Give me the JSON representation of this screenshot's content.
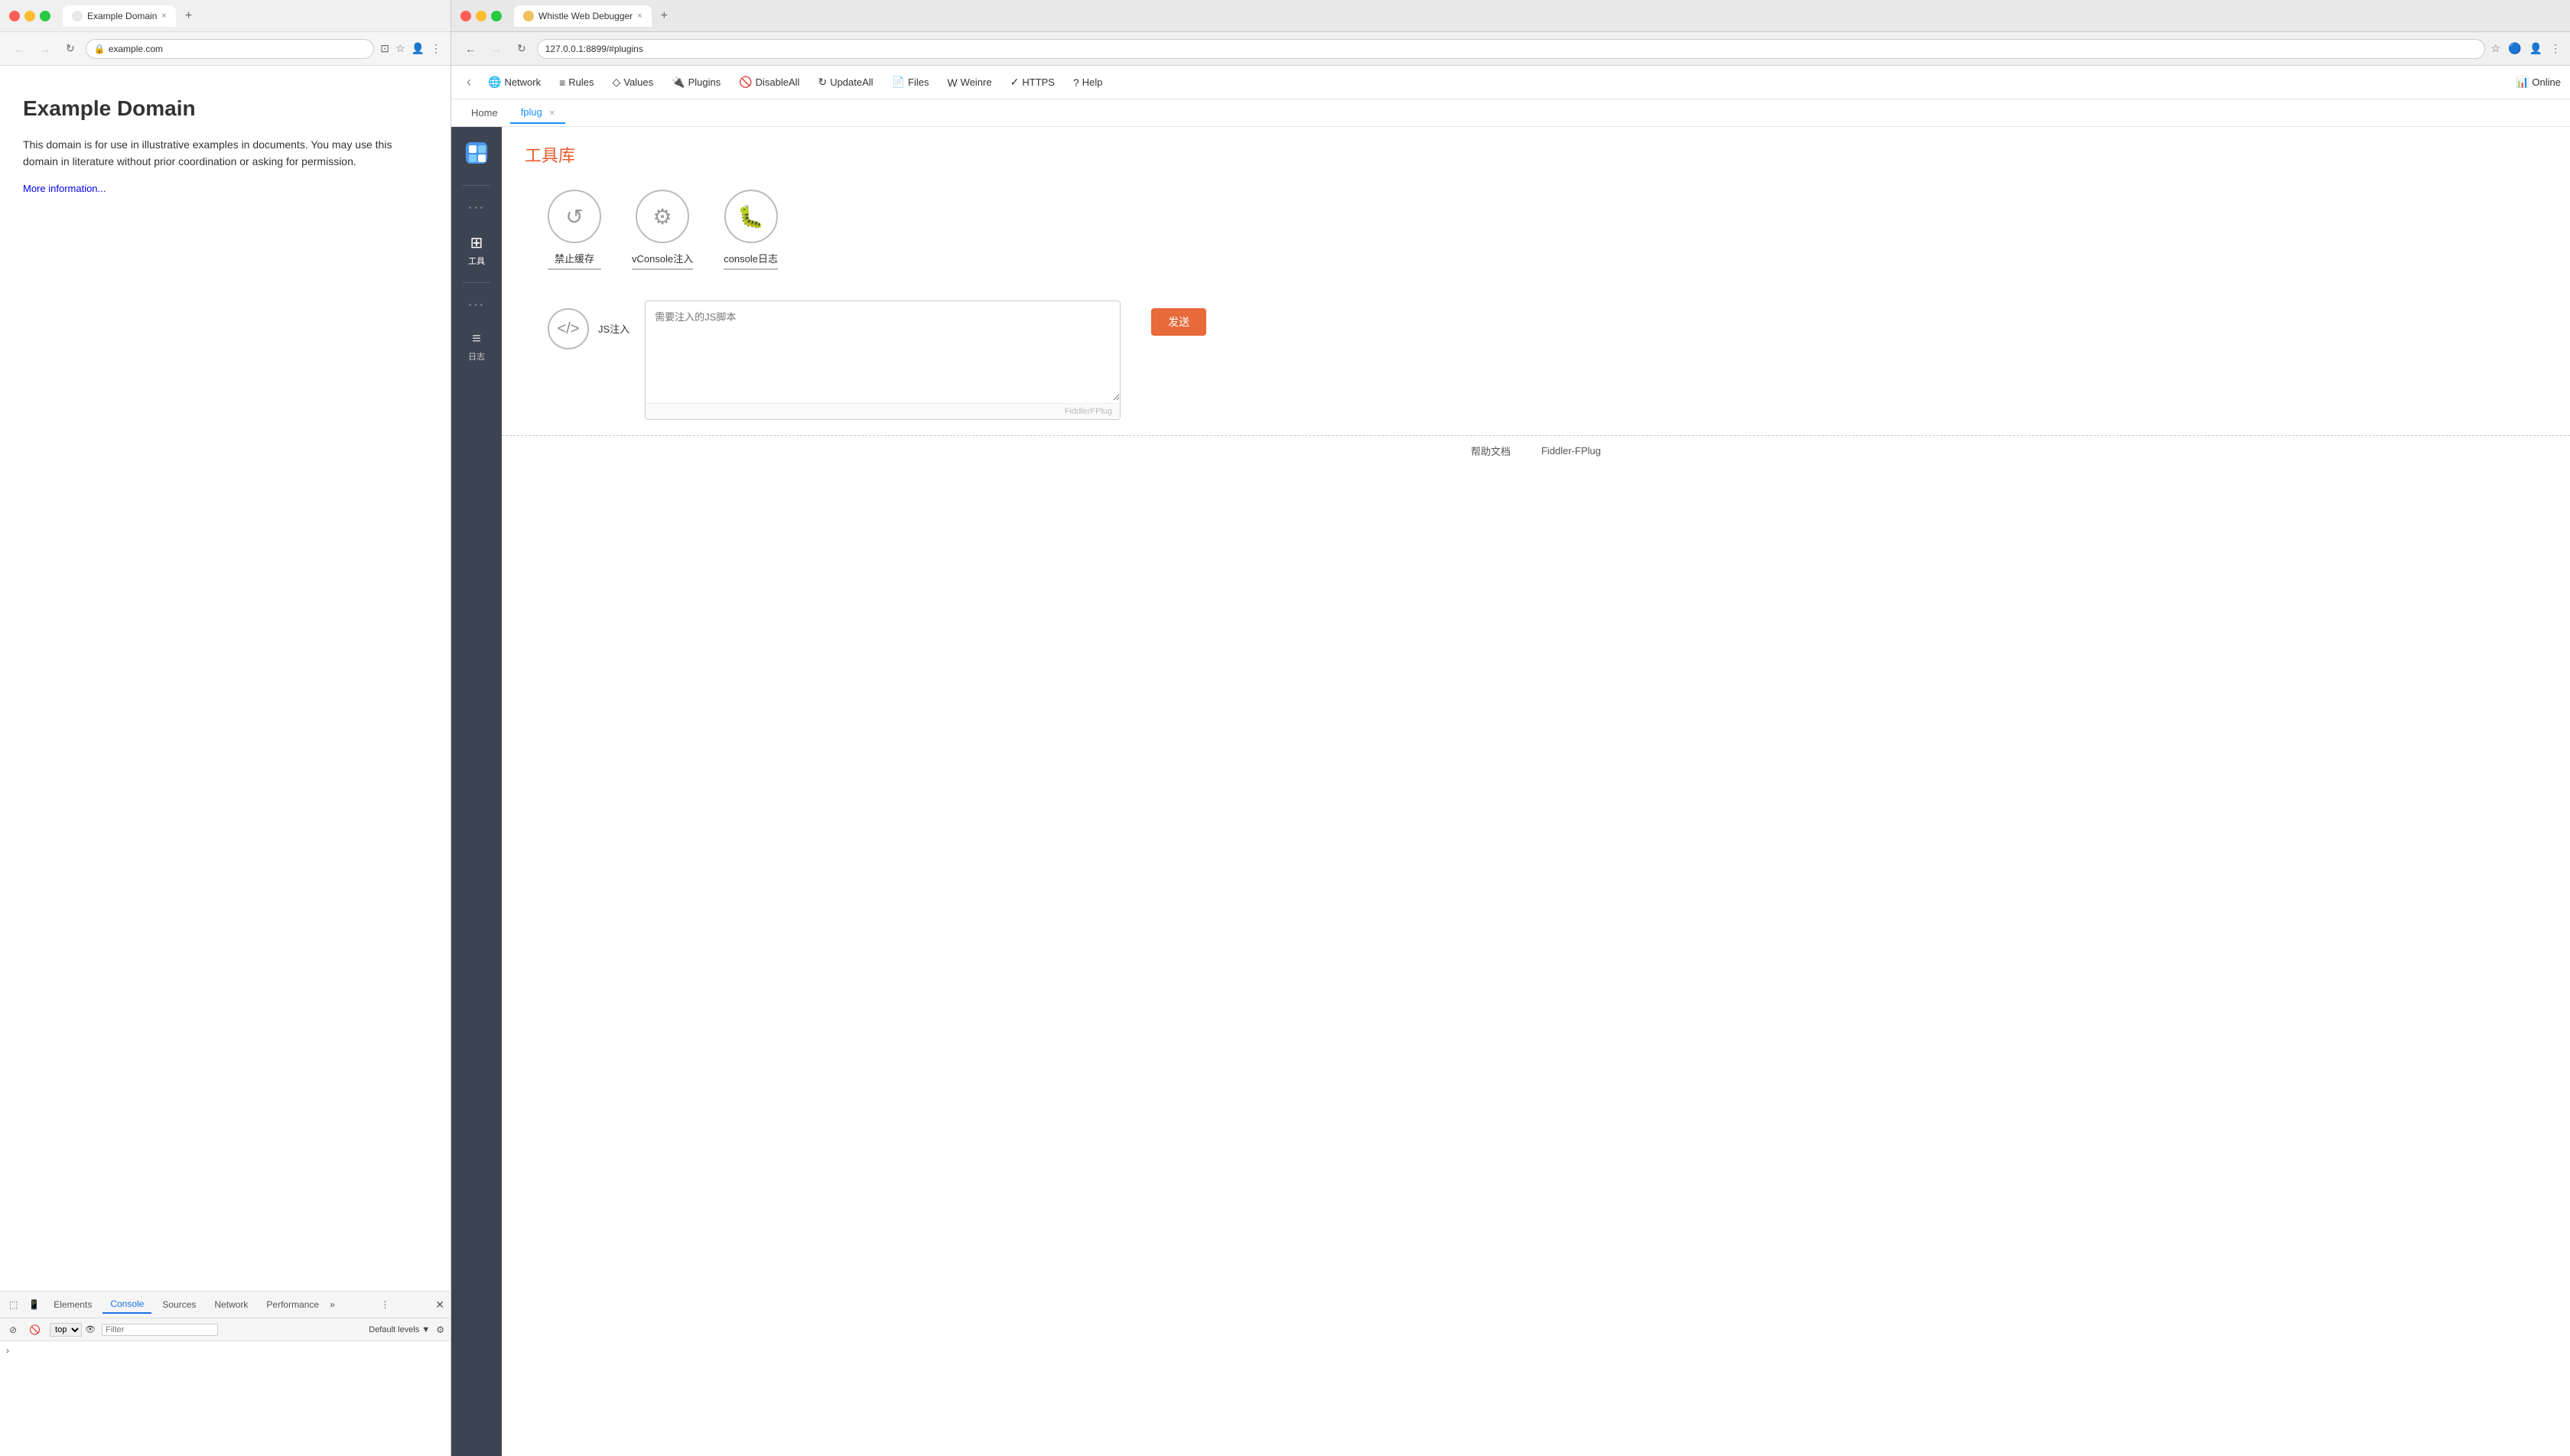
{
  "leftBrowser": {
    "tab": {
      "label": "Example Domain",
      "closeBtn": "×"
    },
    "newTab": "+",
    "addressBar": "example.com",
    "page": {
      "title": "Example Domain",
      "body1": "This domain is for use in illustrative examples in documents. You may use this domain in literature without prior coordination or asking for permission.",
      "linkText": "More information..."
    },
    "devtools": {
      "tabs": [
        "Elements",
        "Console",
        "Sources",
        "Network",
        "Performance"
      ],
      "activeTab": "Console",
      "moreLabel": "»",
      "consoleToolbar": {
        "topLabel": "top",
        "filterPlaceholder": "Filter",
        "levelsLabel": "Default levels ▼"
      }
    }
  },
  "rightBrowser": {
    "tab": {
      "label": "Whistle Web Debugger",
      "closeBtn": "×"
    },
    "newTab": "+",
    "addressBar": "127.0.0.1:8899/#plugins",
    "menubar": {
      "backArrow": "‹",
      "items": [
        {
          "icon": "🌐",
          "label": "Network"
        },
        {
          "icon": "≡",
          "label": "Rules"
        },
        {
          "icon": "◇",
          "label": "Values"
        },
        {
          "icon": "🔌",
          "label": "Plugins"
        },
        {
          "icon": "🚫",
          "label": "DisableAll"
        },
        {
          "icon": "↻",
          "label": "UpdateAll"
        },
        {
          "icon": "📄",
          "label": "Files"
        },
        {
          "icon": "W",
          "label": "Weinre"
        },
        {
          "icon": "✓",
          "label": "HTTPS"
        },
        {
          "icon": "?",
          "label": "Help"
        }
      ],
      "onlineLabel": "Online"
    },
    "tabs": [
      {
        "label": "Home",
        "active": false
      },
      {
        "label": "fplug",
        "active": true,
        "closeable": true
      }
    ]
  },
  "sidebar": {
    "items": [
      {
        "type": "dots",
        "label": "",
        "active": false
      },
      {
        "type": "icon",
        "icon": "⊞",
        "label": "工具",
        "active": true
      },
      {
        "type": "dots",
        "label": "",
        "active": false
      },
      {
        "type": "icon",
        "icon": "≡",
        "label": "日志",
        "active": false
      }
    ]
  },
  "plugin": {
    "title": "工具库",
    "tools": [
      {
        "icon": "↺",
        "label": "禁止缓存"
      },
      {
        "icon": "⚙",
        "label": "vConsole注入"
      },
      {
        "icon": "🐛",
        "label": "console日志"
      }
    ],
    "jsInject": {
      "circleIcon": "</>",
      "label": "JS注入",
      "textareaPlaceholder": "需要注入的JS脚本",
      "sendBtn": "发送",
      "textareaFooter": "FiddlerFPlug"
    }
  },
  "footer": {
    "links": [
      "帮助文档",
      "Fiddler-FPlug"
    ]
  }
}
